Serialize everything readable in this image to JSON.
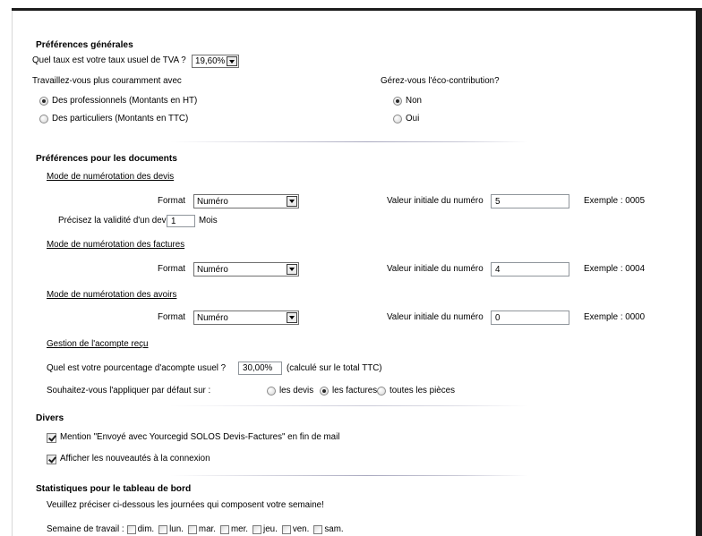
{
  "general": {
    "title": "Préférences générales",
    "vat": {
      "label": "Quel taux est votre taux usuel de TVA ?",
      "value": "19,60%"
    },
    "customer_type": {
      "label": "Travaillez-vous plus couramment avec",
      "options": [
        {
          "label": "Des professionnels (Montants en HT)",
          "checked": true
        },
        {
          "label": "Des particuliers (Montants en TTC)",
          "checked": false
        }
      ]
    },
    "eco_contribution": {
      "label": "Gérez-vous l'éco-contribution?",
      "options": [
        {
          "label": "Non",
          "checked": true
        },
        {
          "label": "Oui",
          "checked": false
        }
      ]
    }
  },
  "documents": {
    "title": "Préférences pour les documents",
    "numbering": [
      {
        "heading": "Mode de numérotation des devis",
        "format_label": "Format",
        "format": "Numéro",
        "initial_label": "Valeur initiale du numéro",
        "initial_value": "5",
        "example": "Exemple : 0005"
      },
      {
        "heading": "Mode de numérotation des factures",
        "format_label": "Format",
        "format": "Numéro",
        "initial_label": "Valeur initiale du numéro",
        "initial_value": "4",
        "example": "Exemple : 0004"
      },
      {
        "heading": "Mode de numérotation des avoirs",
        "format_label": "Format",
        "format": "Numéro",
        "initial_label": "Valeur initiale du numéro",
        "initial_value": "0",
        "example": "Exemple : 0000"
      }
    ],
    "quote_validity": {
      "label": "Précisez la validité d'un devis",
      "value": "1",
      "unit": "Mois"
    },
    "deposit": {
      "heading": "Gestion de l'acompte reçu",
      "percent_label": "Quel est votre pourcentage d'acompte usuel ?",
      "percent_value": "30,00%",
      "percent_note": "(calculé sur le total TTC)",
      "apply_label": "Souhaitez-vous l'appliquer par défaut sur :",
      "apply_options": [
        {
          "label": "les devis",
          "checked": false
        },
        {
          "label": "les factures",
          "checked": true
        },
        {
          "label": "toutes les pièces",
          "checked": false
        }
      ]
    }
  },
  "misc": {
    "title": "Divers",
    "options": [
      {
        "label": "Mention \"Envoyé avec Yourcegid SOLOS Devis-Factures\" en fin de mail",
        "checked": true
      },
      {
        "label": "Afficher les nouveautés à la connexion",
        "checked": true
      }
    ]
  },
  "stats": {
    "title": "Statistiques pour le tableau de bord",
    "hint": "Veuillez préciser ci-dessous les journées qui composent votre semaine!",
    "week_label": "Semaine de travail :",
    "days": [
      {
        "label": "dim.",
        "checked": false
      },
      {
        "label": "lun.",
        "checked": false
      },
      {
        "label": "mar.",
        "checked": false
      },
      {
        "label": "mer.",
        "checked": false
      },
      {
        "label": "jeu.",
        "checked": false
      },
      {
        "label": "ven.",
        "checked": false
      },
      {
        "label": "sam.",
        "checked": false
      }
    ]
  },
  "colors": {
    "text": "#000000",
    "frame": "#1c1c1c",
    "separator": "#a9a9bf",
    "radio_dot": "#2a2a2a"
  }
}
